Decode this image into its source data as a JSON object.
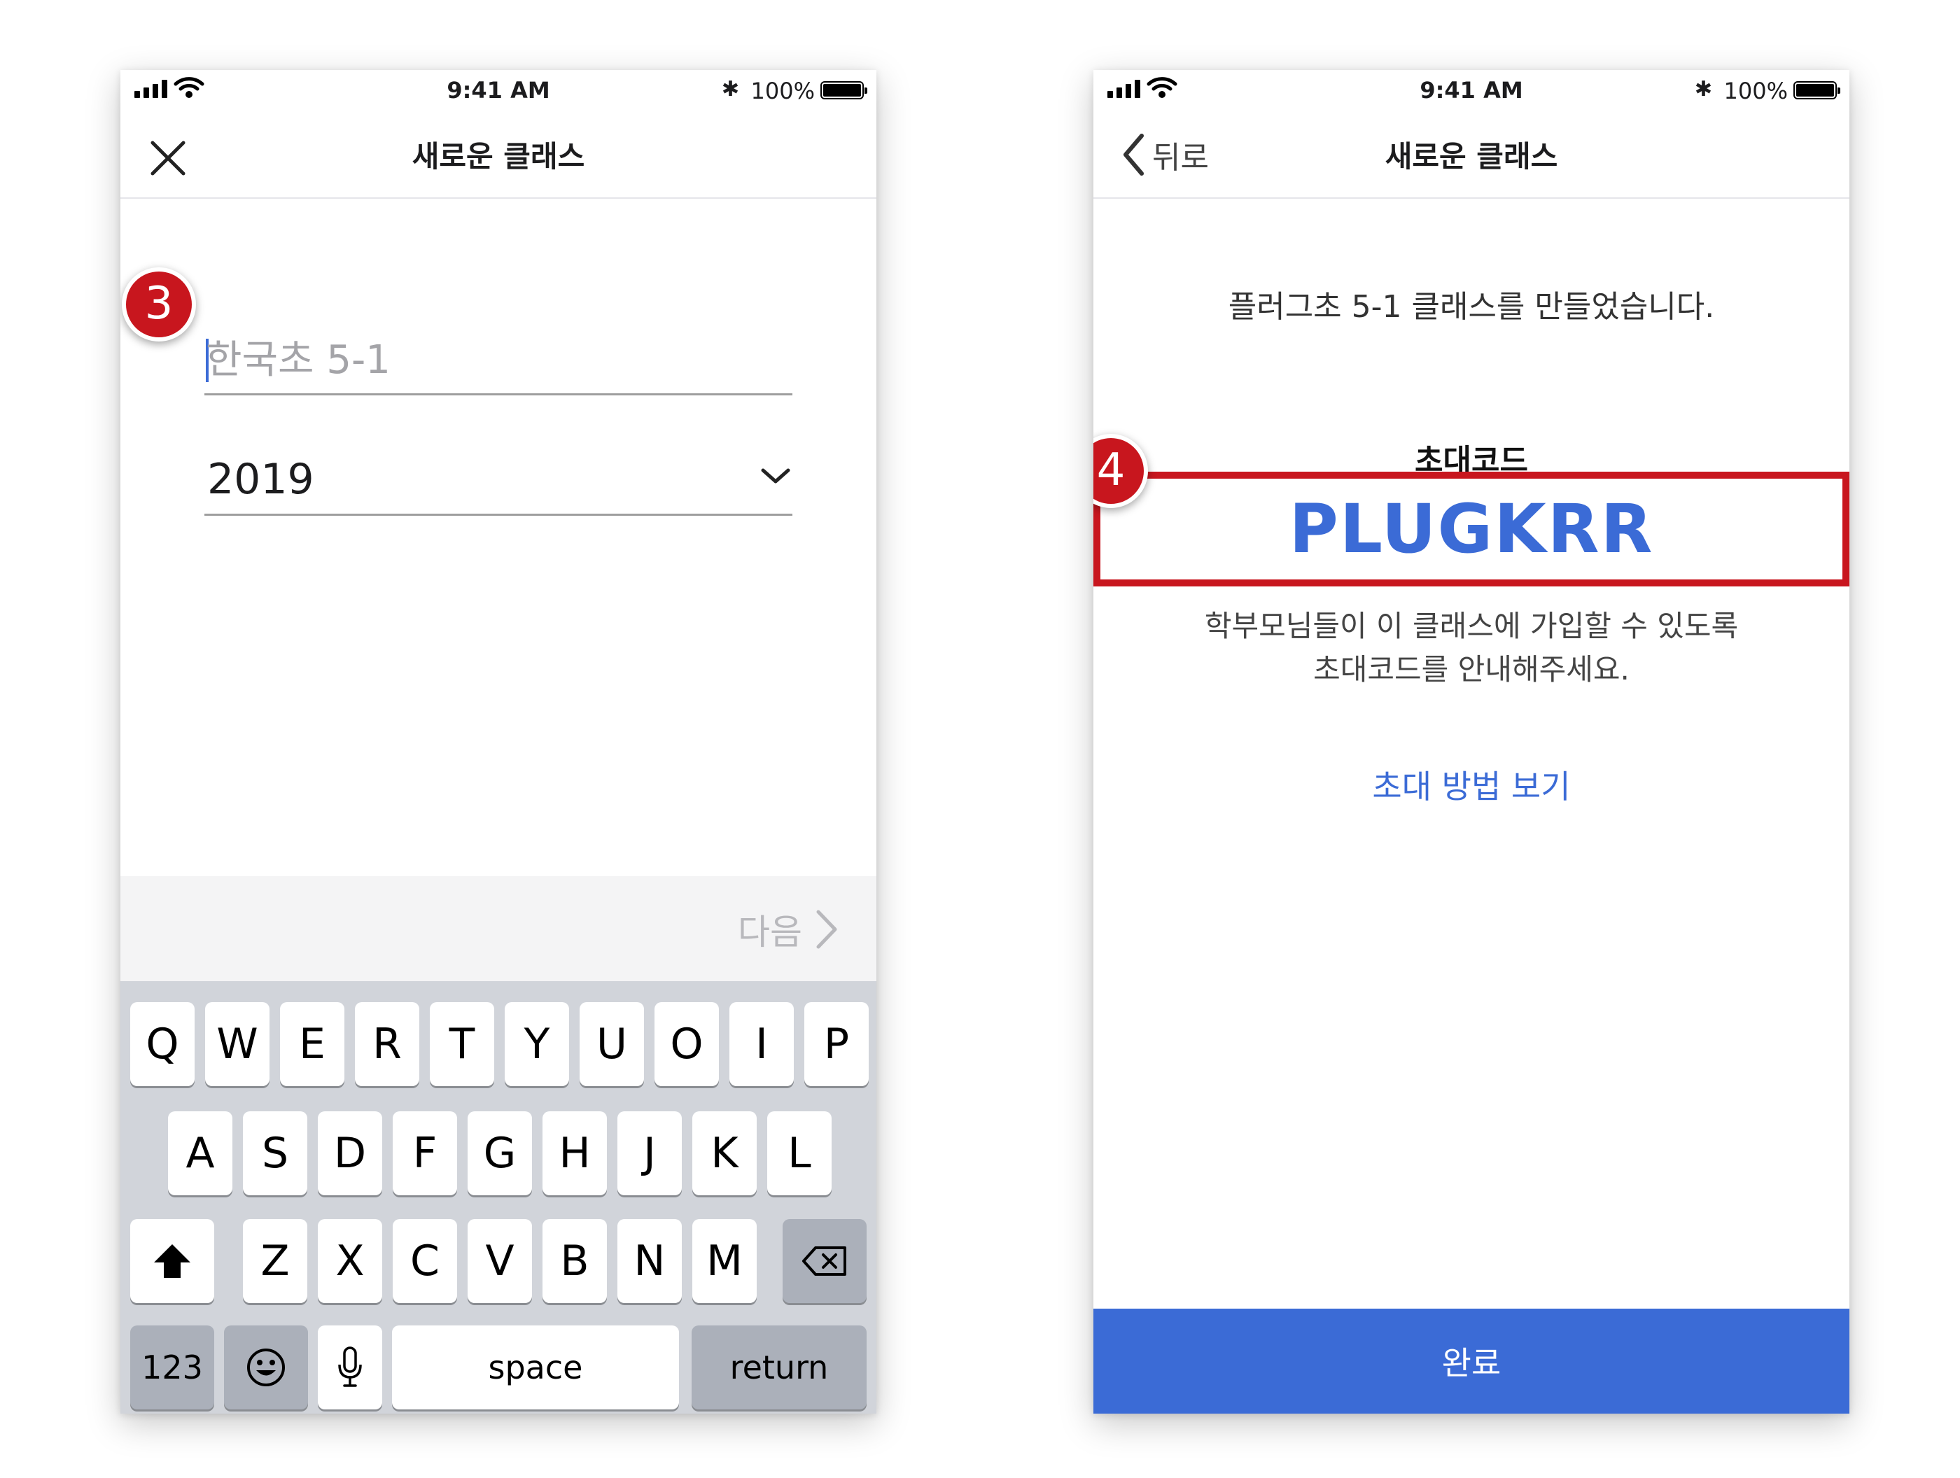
{
  "left_screen": {
    "status": {
      "time": "9:41 AM",
      "battery": "100%",
      "bluetooth_symbol": "✱"
    },
    "nav": {
      "title": "새로운 클래스",
      "close_icon": "close-icon"
    },
    "step_badge": "3",
    "form": {
      "name_placeholder": "한국초 5-1",
      "name_value": "",
      "year_value": "2019"
    },
    "next": {
      "label": "다음"
    },
    "keyboard": {
      "row1": [
        "Q",
        "W",
        "E",
        "R",
        "T",
        "Y",
        "U",
        "O",
        "I",
        "P"
      ],
      "row2": [
        "A",
        "S",
        "D",
        "F",
        "G",
        "H",
        "J",
        "K",
        "L"
      ],
      "row3": [
        "Z",
        "X",
        "C",
        "V",
        "B",
        "N",
        "M"
      ],
      "numbers_key": "123",
      "space_key": "space",
      "return_key": "return",
      "icons": [
        "shift-icon",
        "delete-icon",
        "emoji-icon",
        "microphone-icon"
      ]
    }
  },
  "right_screen": {
    "status": {
      "time": "9:41 AM",
      "battery": "100%",
      "bluetooth_symbol": "✱"
    },
    "nav": {
      "title": "새로운 클래스",
      "back_label": "뒤로"
    },
    "step_badge": "4",
    "created_message": "플러그초 5-1 클래스를 만들었습니다.",
    "invite": {
      "label": "초대코드",
      "code": "PLUGKRR",
      "guide_line1": "학부모님들이 이 클래스에 가입할 수 있도록",
      "guide_line2": "초대코드를 안내해주세요."
    },
    "how_link": "초대 방법 보기",
    "done_button": "완료"
  },
  "colors": {
    "accent_blue": "#3b6bd6",
    "highlight_red": "#c8161e",
    "keyboard_bg": "#d1d4da"
  }
}
